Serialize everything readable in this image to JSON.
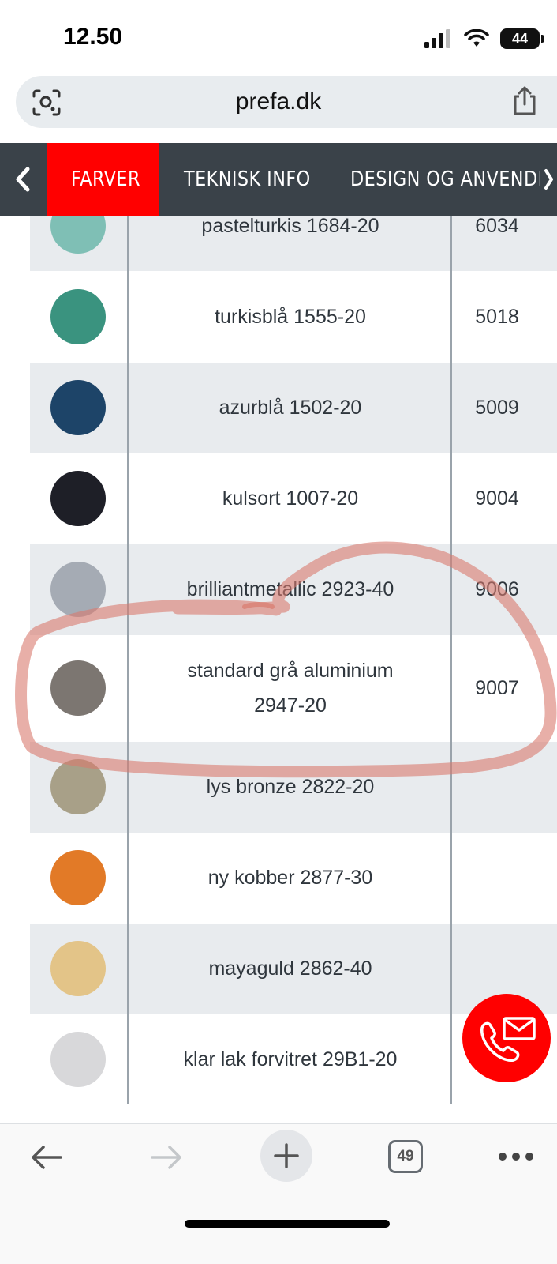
{
  "status_bar": {
    "time": "12.50",
    "battery": "44"
  },
  "browser": {
    "url": "prefa.dk",
    "tab_count": "49"
  },
  "tabs": {
    "items": [
      {
        "label": "FARVER",
        "active": true
      },
      {
        "label": "TEKNISK INFO",
        "active": false
      },
      {
        "label": "DESIGN OG ANVENDEL",
        "active": false
      }
    ]
  },
  "colors": [
    {
      "name": "pastelturkis 1684-20",
      "code": "6034",
      "swatch": "#7fbfb5"
    },
    {
      "name": "turkisblå 1555-20",
      "code": "5018",
      "swatch": "#3a937f"
    },
    {
      "name": "azurblå 1502-20",
      "code": "5009",
      "swatch": "#1d4468"
    },
    {
      "name": "kulsort 1007-20",
      "code": "9004",
      "swatch": "#1e1f27"
    },
    {
      "name": "brilliantmetallic 2923-40",
      "code": "9006",
      "swatch": "#a5abb4"
    },
    {
      "name": "standard grå aluminium",
      "name_line2": "2947-20",
      "code": "9007",
      "swatch": "#7c7671"
    },
    {
      "name": "lys bronze 2822-20",
      "code": "",
      "swatch": "#a8a088"
    },
    {
      "name": "ny kobber 2877-30",
      "code": "",
      "swatch": "#e27a27"
    },
    {
      "name": "mayaguld 2862-40",
      "code": "",
      "swatch": "#e3c488"
    },
    {
      "name": "klar lak forvitret 29B1-20",
      "code": "",
      "swatch": "#d8d8da"
    }
  ],
  "accent_color": "#ff0000",
  "highlight_color": "#d97a6e",
  "icons": {
    "back": "chevron-left-icon",
    "contact": "phone-mail-icon",
    "lens": "lens-icon",
    "share": "share-icon"
  }
}
